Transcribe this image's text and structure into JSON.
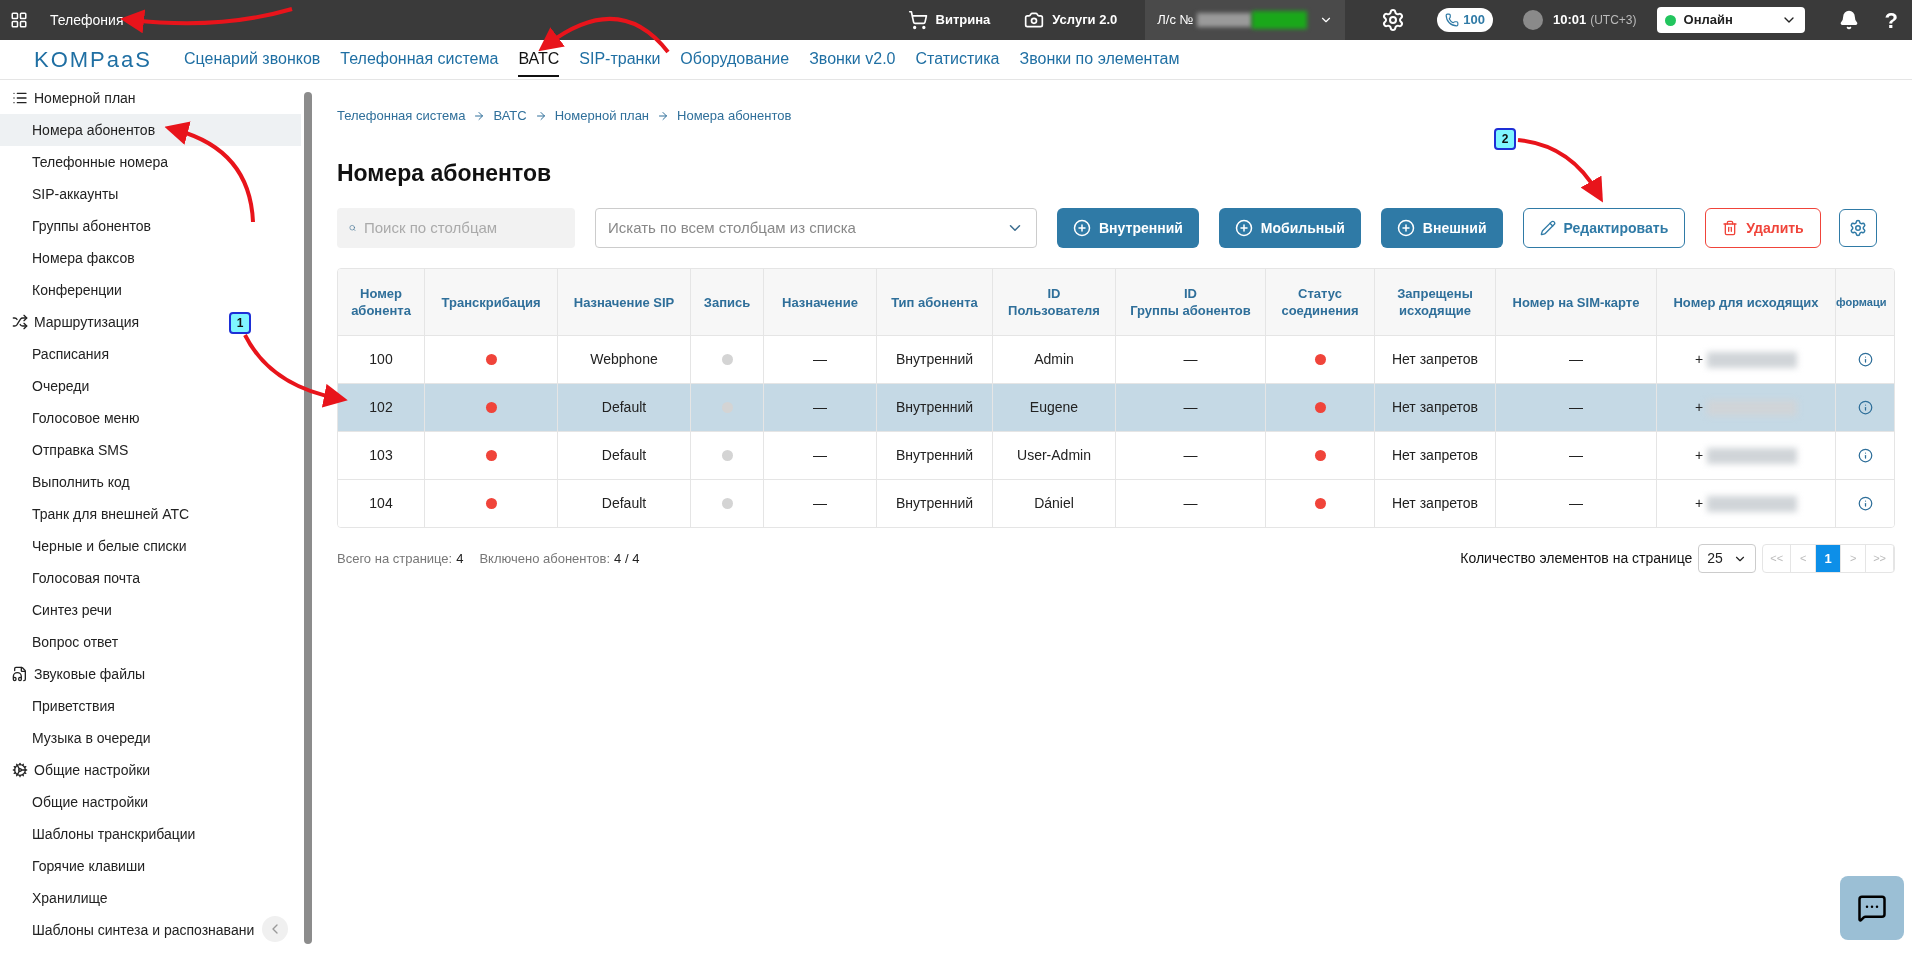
{
  "topbar": {
    "app_title": "Телефония",
    "storefront": "Витрина",
    "services": "Услуги 2.0",
    "account_label": "Л/с №",
    "phone_badge": "100",
    "time": "10:01",
    "timezone": "(UTC+3)",
    "status": {
      "value": "Онлайн",
      "color": "#22c55e"
    },
    "help": "?"
  },
  "nav": {
    "logo": "KOMPaaS",
    "tabs": [
      {
        "label": "Сценарий звонков",
        "selected": false
      },
      {
        "label": "Телефонная система",
        "selected": false
      },
      {
        "label": "ВАТС",
        "selected": true
      },
      {
        "label": "SIP-транки",
        "selected": false
      },
      {
        "label": "Оборудование",
        "selected": false
      },
      {
        "label": "Звонки v2.0",
        "selected": false
      },
      {
        "label": "Статистика",
        "selected": false
      },
      {
        "label": "Звонки по элементам",
        "selected": false
      }
    ]
  },
  "sidebar": {
    "sections": [
      {
        "label": "Номерной план",
        "children": [
          {
            "label": "Номера абонентов",
            "selected": true
          },
          {
            "label": "Телефонные номера",
            "selected": false
          },
          {
            "label": "SIP-аккаунты",
            "selected": false
          },
          {
            "label": "Группы абонентов",
            "selected": false
          },
          {
            "label": "Номера факсов",
            "selected": false
          },
          {
            "label": "Конференции",
            "selected": false
          }
        ]
      },
      {
        "label": "Маршрутизация",
        "children": [
          {
            "label": "Расписания",
            "selected": false
          },
          {
            "label": "Очереди",
            "selected": false
          },
          {
            "label": "Голосовое меню",
            "selected": false
          },
          {
            "label": "Отправка SMS",
            "selected": false
          },
          {
            "label": "Выполнить код",
            "selected": false
          },
          {
            "label": "Транк для внешней АТС",
            "selected": false
          },
          {
            "label": "Черные и белые списки",
            "selected": false
          },
          {
            "label": "Голосовая почта",
            "selected": false
          },
          {
            "label": "Синтез речи",
            "selected": false
          },
          {
            "label": "Вопрос ответ",
            "selected": false
          }
        ]
      },
      {
        "label": "Звуковые файлы",
        "children": [
          {
            "label": "Приветствия",
            "selected": false
          },
          {
            "label": "Музыка в очереди",
            "selected": false
          }
        ]
      },
      {
        "label": "Общие настройки",
        "children": [
          {
            "label": "Общие настройки",
            "selected": false
          },
          {
            "label": "Шаблоны транскрибации",
            "selected": false
          },
          {
            "label": "Горячие клавиши",
            "selected": false
          },
          {
            "label": "Хранилище",
            "selected": false
          },
          {
            "label": "Шаблоны синтеза и распознавани",
            "selected": false
          }
        ]
      }
    ]
  },
  "breadcrumbs": [
    "Телефонная система",
    "ВАТС",
    "Номерной план",
    "Номера абонентов"
  ],
  "title": "Номера абонентов",
  "toolbar": {
    "column_search": {
      "placeholder": "Поиск по столбцам"
    },
    "all_search": {
      "placeholder": "Искать по всем столбцам из списка"
    },
    "buttons": [
      {
        "label": "Внутренний",
        "kind": "add"
      },
      {
        "label": "Мобильный",
        "kind": "add"
      },
      {
        "label": "Внешний",
        "kind": "add"
      },
      {
        "label": "Редактировать",
        "kind": "edit"
      },
      {
        "label": "Удалить",
        "kind": "delete"
      }
    ]
  },
  "table": {
    "columns": [
      "Номер абонента",
      "Транскрибация",
      "Назначение SIP",
      "Запись",
      "Назначение",
      "Тип абонента",
      "ID Пользователя",
      "ID Группы абонентов",
      "Статус соединения",
      "Запрещены исходящие",
      "Номер на SIM-карте",
      "Номер для исходящих",
      "формаци"
    ],
    "rows": [
      {
        "number": "100",
        "transcription": {
          "color": "#f0443a"
        },
        "sip": "Webphone",
        "record": {
          "color": "#d4d4d4"
        },
        "destination": "—",
        "type": "Внутренний",
        "user_id": "Admin",
        "group_id": "—",
        "status": {
          "color": "#f0443a"
        },
        "restrictions": "Нет запретов",
        "sim": "—",
        "outgoing": "+",
        "selected": false
      },
      {
        "number": "102",
        "transcription": {
          "color": "#f0443a"
        },
        "sip": "Default",
        "record": {
          "color": "#d4d4d4"
        },
        "destination": "—",
        "type": "Внутренний",
        "user_id": "Eugene",
        "group_id": "—",
        "status": {
          "color": "#f0443a"
        },
        "restrictions": "Нет запретов",
        "sim": "—",
        "outgoing": "+",
        "selected": true
      },
      {
        "number": "103",
        "transcription": {
          "color": "#f0443a"
        },
        "sip": "Default",
        "record": {
          "color": "#d4d4d4"
        },
        "destination": "—",
        "type": "Внутренний",
        "user_id": "User-Admin",
        "group_id": "—",
        "status": {
          "color": "#f0443a"
        },
        "restrictions": "Нет запретов",
        "sim": "—",
        "outgoing": "+",
        "selected": false
      },
      {
        "number": "104",
        "transcription": {
          "color": "#f0443a"
        },
        "sip": "Default",
        "record": {
          "color": "#d4d4d4"
        },
        "destination": "—",
        "type": "Внутренний",
        "user_id": "Dániel",
        "group_id": "—",
        "status": {
          "color": "#f0443a"
        },
        "restrictions": "Нет запретов",
        "sim": "—",
        "outgoing": "+",
        "selected": false
      }
    ]
  },
  "footer": {
    "page_total_label": "Всего на странице:",
    "page_total": "4",
    "enabled_label": "Включено абонентов:",
    "enabled": "4 / 4",
    "per_page_label": "Количество элементов на странице",
    "per_page": "25",
    "pager": [
      {
        "label": "<<",
        "selected": false
      },
      {
        "label": "<",
        "selected": false
      },
      {
        "label": "1",
        "selected": true
      },
      {
        "label": ">",
        "selected": false
      },
      {
        "label": ">>",
        "selected": false
      }
    ]
  },
  "annotations": [
    {
      "label": "1"
    },
    {
      "label": "2"
    }
  ]
}
